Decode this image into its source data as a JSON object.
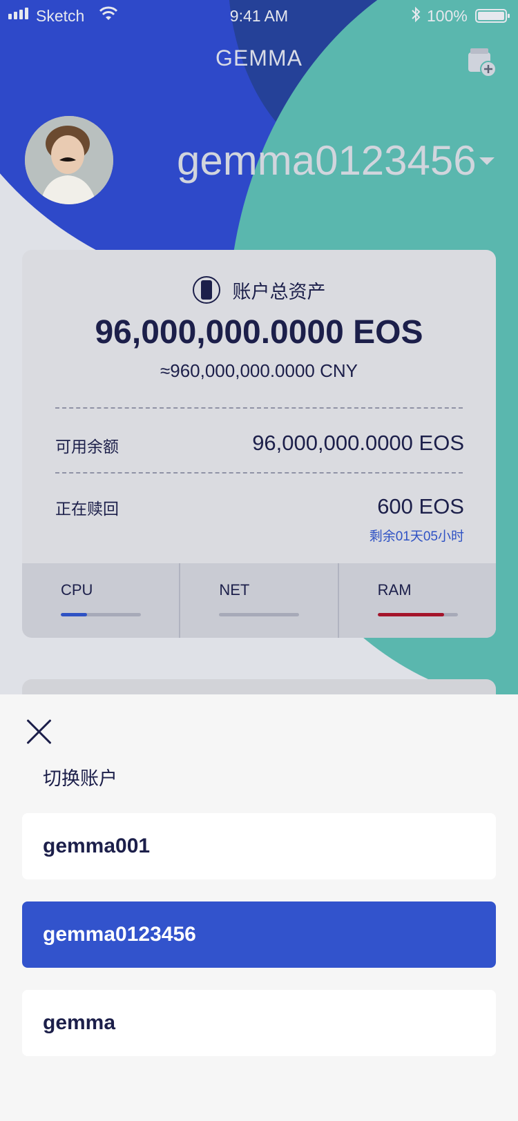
{
  "status_bar": {
    "carrier": "Sketch",
    "time": "9:41 AM",
    "battery": "100%"
  },
  "header": {
    "title": "GEMMA",
    "add_wallet_icon": "wallet-add-icon"
  },
  "account": {
    "name": "gemma0123456"
  },
  "assets": {
    "title": "账户总资产",
    "total_eos": "96,000,000.0000 EOS",
    "total_cny": "≈960,000,000.0000 CNY",
    "available_label": "可用余额",
    "available_value": "96,000,000.0000 EOS",
    "redeeming_label": "正在赎回",
    "redeeming_value": "600 EOS",
    "redeeming_remaining": "剩余01天05小时"
  },
  "resources": [
    {
      "label": "CPU",
      "usage": 0.33,
      "color": "#2f52c4"
    },
    {
      "label": "NET",
      "usage": 0.0,
      "color": "#2f52c4"
    },
    {
      "label": "RAM",
      "usage": 0.83,
      "color": "#a4142a"
    }
  ],
  "switch_sheet": {
    "title": "切换账户",
    "accounts": [
      {
        "name": "gemma001",
        "selected": false
      },
      {
        "name": "gemma0123456",
        "selected": true
      },
      {
        "name": "gemma",
        "selected": false
      }
    ]
  },
  "colors": {
    "primary_blue": "#3253cc",
    "teal": "#5ab7ae",
    "text_dark": "#1c1f4a"
  }
}
